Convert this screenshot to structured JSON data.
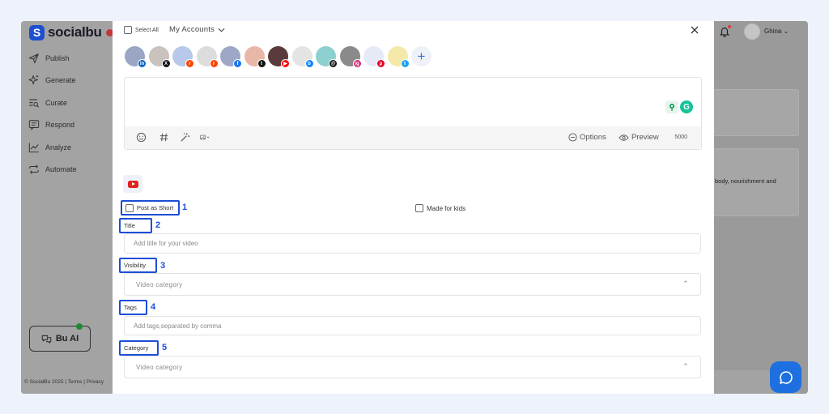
{
  "brand": {
    "name": "socialbu"
  },
  "sidebar": {
    "items": [
      {
        "label": "Publish",
        "icon": "send-icon"
      },
      {
        "label": "Generate",
        "icon": "sparkle-icon"
      },
      {
        "label": "Curate",
        "icon": "curate-icon"
      },
      {
        "label": "Respond",
        "icon": "message-icon"
      },
      {
        "label": "Analyze",
        "icon": "chart-line-icon"
      },
      {
        "label": "Automate",
        "icon": "repeat-icon"
      }
    ],
    "bu_ai_label": "Bu AI",
    "footer": "© SocialBu 2025 | Terms | Privacy"
  },
  "header": {
    "user_name": "Ghina"
  },
  "background": {
    "snippet": "body, nourishment and"
  },
  "modal": {
    "select_all_label": "Select All",
    "accounts_dropdown_label": "My Accounts",
    "accounts": [
      {
        "network": "linkedin",
        "badge": "in",
        "avatar_color": "#9aa6c4",
        "badge_color": "#0a66c2"
      },
      {
        "network": "x",
        "badge": "X",
        "avatar_color": "#c9c2bd",
        "badge_color": "#111111"
      },
      {
        "network": "reddit",
        "badge": "r",
        "avatar_color": "#b7c8ea",
        "badge_color": "#ff4500"
      },
      {
        "network": "reddit",
        "badge": "r",
        "avatar_color": "#dcdcdc",
        "badge_color": "#ff4500"
      },
      {
        "network": "facebook",
        "badge": "f",
        "avatar_color": "#9fa7c6",
        "badge_color": "#1877f2"
      },
      {
        "network": "tiktok",
        "badge": "t",
        "avatar_color": "#e8b7a8",
        "badge_color": "#111111"
      },
      {
        "network": "youtube",
        "badge": "▶",
        "avatar_color": "#5a3a3a",
        "badge_color": "#ff0000"
      },
      {
        "network": "bluesky",
        "badge": "b",
        "avatar_color": "#e4e4e4",
        "badge_color": "#1185fe"
      },
      {
        "network": "threads",
        "badge": "@",
        "avatar_color": "#8ecfcf",
        "badge_color": "#111111"
      },
      {
        "network": "instagram",
        "badge": "ig",
        "avatar_color": "#8a8a8a",
        "badge_color": "#d62976"
      },
      {
        "network": "pinterest",
        "badge": "p",
        "avatar_color": "#e6e9f6",
        "badge_color": "#e60023"
      },
      {
        "network": "twitter",
        "badge": "t",
        "avatar_color": "#f4e9a8",
        "badge_color": "#1da1f2"
      }
    ],
    "toolbar": {
      "options_label": "Options",
      "preview_label": "Preview",
      "char_count": "5000"
    },
    "post_as_short_label": "Post as Short",
    "made_for_kids_label": "Made for kids",
    "title_label": "Title",
    "title_placeholder": "Add title for your video",
    "visibility_label": "Visibility",
    "visibility_value": "Video category",
    "tags_label": "Tags",
    "tags_placeholder": "Add tags,separated by comma",
    "category_label": "Category",
    "category_value": "Video category"
  },
  "annotations": [
    "1",
    "2",
    "3",
    "4",
    "5"
  ],
  "colors": {
    "highlight": "#1d4ed8",
    "brand": "#1e4fcf",
    "fab": "#1e6fe0"
  }
}
